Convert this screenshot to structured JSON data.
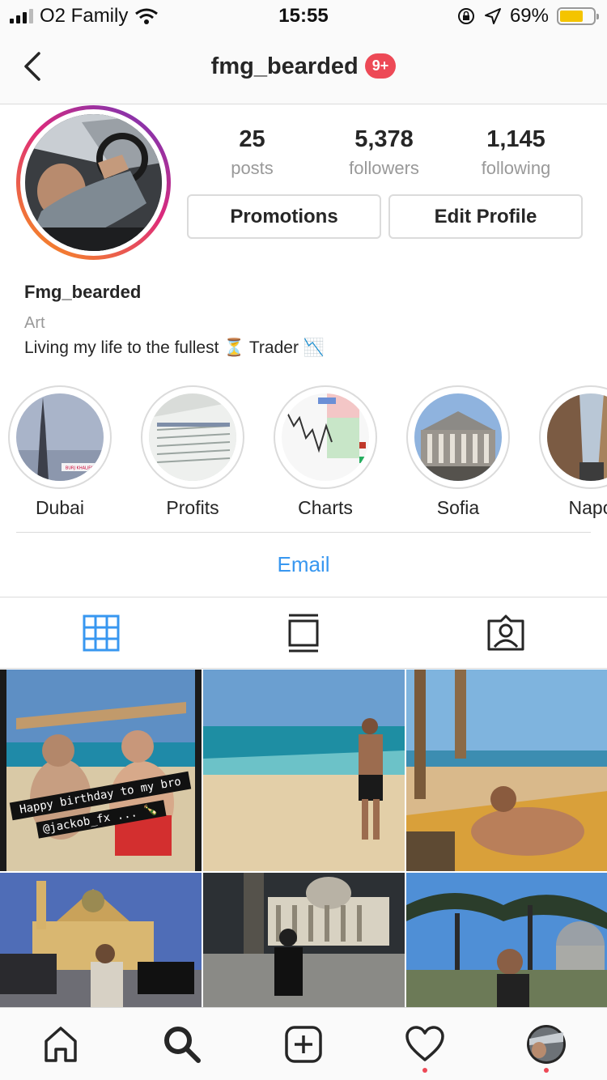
{
  "status": {
    "carrier": "O2 Family",
    "time": "15:55",
    "battery": "69%",
    "battery_level": 0.69
  },
  "header": {
    "username": "fmg_bearded",
    "badge": "9+"
  },
  "profile": {
    "posts_count": "25",
    "posts_label": "posts",
    "followers_count": "5,378",
    "followers_label": "followers",
    "following_count": "1,145",
    "following_label": "following",
    "promotions_label": "Promotions",
    "edit_profile_label": "Edit Profile",
    "display_name": "Fmg_bearded",
    "category": "Art",
    "bio": "Living my life to the fullest ⏳ Trader 📉"
  },
  "highlights": [
    {
      "label": "Dubai",
      "sign": "BURJ KHALIFA"
    },
    {
      "label": "Profits"
    },
    {
      "label": "Charts"
    },
    {
      "label": "Sofia"
    },
    {
      "label": "Napo"
    }
  ],
  "contact": {
    "email_label": "Email"
  },
  "posts": {
    "caption_line1": "Happy birthday to my bro",
    "caption_line2": "@jackob_fx ... 🍾"
  },
  "colors": {
    "accent": "#3897f0",
    "badge": "#ed4956",
    "battery": "#f4c400"
  },
  "icons": [
    "back-arrow-icon",
    "grid-icon",
    "feed-icon",
    "tagged-icon",
    "home-icon",
    "search-icon",
    "add-icon",
    "heart-icon",
    "profile-icon"
  ]
}
